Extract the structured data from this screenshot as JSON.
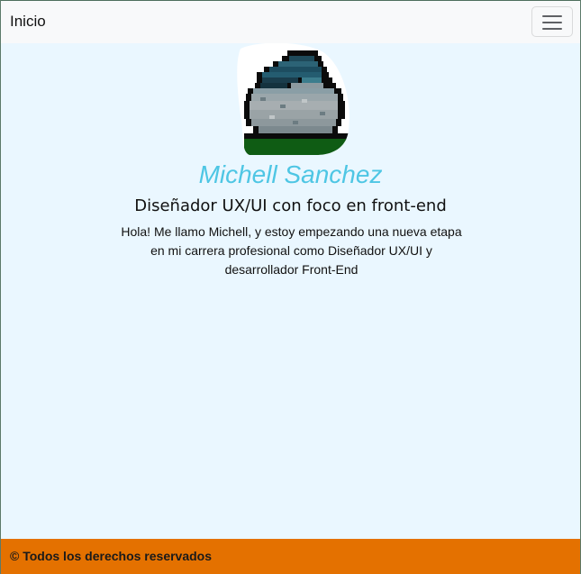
{
  "navbar": {
    "brand": "Inicio",
    "toggle_icon": "hamburger-menu-icon"
  },
  "profile": {
    "avatar_icon": "pixel-art-cloud-avatar",
    "name": "Michell Sanchez",
    "role": "Diseñador UX/UI con foco en front-end",
    "bio": "Hola! Me llamo Michell, y estoy empezando una nueva etapa en mi carrera profesional como Diseñador UX/UI y desarrollador Front-End"
  },
  "footer": {
    "text": "© Todos los derechos reservados"
  },
  "colors": {
    "background": "#eaf7ff",
    "navbar": "#f8f9fa",
    "name": "#4ec6e4",
    "footer": "#e47100"
  }
}
